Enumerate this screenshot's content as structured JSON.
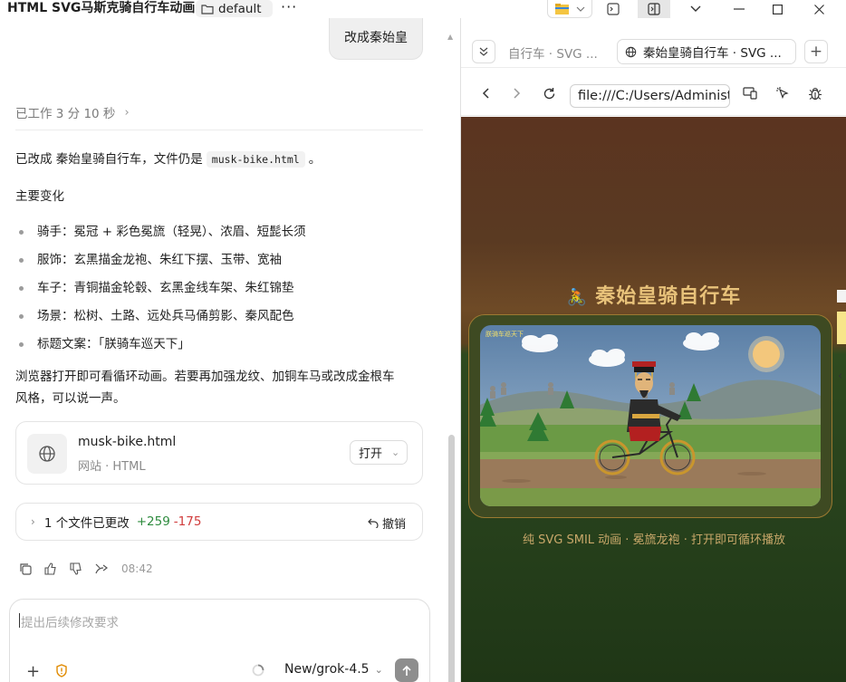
{
  "window": {
    "title": "HTML SVG马斯克骑自行车动画",
    "folder_label": "default",
    "more_label": "···"
  },
  "chat": {
    "user_message": "改成秦始皇",
    "worked_label": "已工作 3 分 10 秒",
    "reply_intro_before": "已改成 秦始皇骑自行车，文件仍是",
    "reply_intro_file": "musk-bike.html",
    "reply_intro_after": "。",
    "changes_heading": "主要变化",
    "bullets": [
      "骑手：冕冠 + 彩色冕旒（轻晃）、浓眉、短髭长须",
      "服饰：玄黑描金龙袍、朱红下摆、玉带、宽袖",
      "车子：青铜描金轮毂、玄黑金线车架、朱红锦垫",
      "场景：松树、土路、远处兵马俑剪影、秦风配色",
      "标题文案：「朕骑车巡天下」"
    ],
    "closing_line1": "浏览器打开即可看循环动画。若要再加强龙纹、加铜车马或改成金根车",
    "closing_line2": "风格，可以说一声。",
    "file_card": {
      "name": "musk-bike.html",
      "subtitle": "网站 · HTML",
      "open_label": "打开"
    },
    "changes_card": {
      "label": "1 个文件已更改",
      "added": "+259",
      "removed": "-175",
      "undo_label": "撤销"
    },
    "timestamp": "08:42",
    "composer": {
      "placeholder": "提出后续修改要求",
      "model_label": "New/grok-4.5"
    }
  },
  "browser": {
    "inactive_tab_label": "自行车 · SVG ...",
    "active_tab_label": "秦始皇骑自行车 · SVG ...",
    "url": "file:///C:/Users/Administ",
    "page": {
      "heading_emoji": "🚴",
      "heading": "秦始皇骑自行车",
      "scene_tag": "朕骑车巡天下",
      "caption": "纯 SVG SMIL 动画 · 冕旒龙袍 · 打开即可循环播放"
    }
  },
  "colors": {
    "accent_gold": "#e8c27a",
    "added_green": "#2e8b3e",
    "removed_red": "#d03b3b",
    "bg_brown": "#5b3420",
    "bg_green": "#27411c"
  },
  "icons": [
    "folder-icon",
    "more-icon",
    "file-explorer-icon",
    "terminal-icon",
    "split-view-icon",
    "chevron-down-icon",
    "minimize-icon",
    "maximize-icon",
    "close-icon",
    "globe-icon",
    "copy-icon",
    "thumbs-up-icon",
    "thumbs-down-icon",
    "share-icon",
    "plus-icon",
    "shield-icon",
    "spinner-icon",
    "send-icon",
    "back-icon",
    "forward-icon",
    "reload-icon",
    "device-icon",
    "pointer-icon",
    "bug-icon"
  ]
}
